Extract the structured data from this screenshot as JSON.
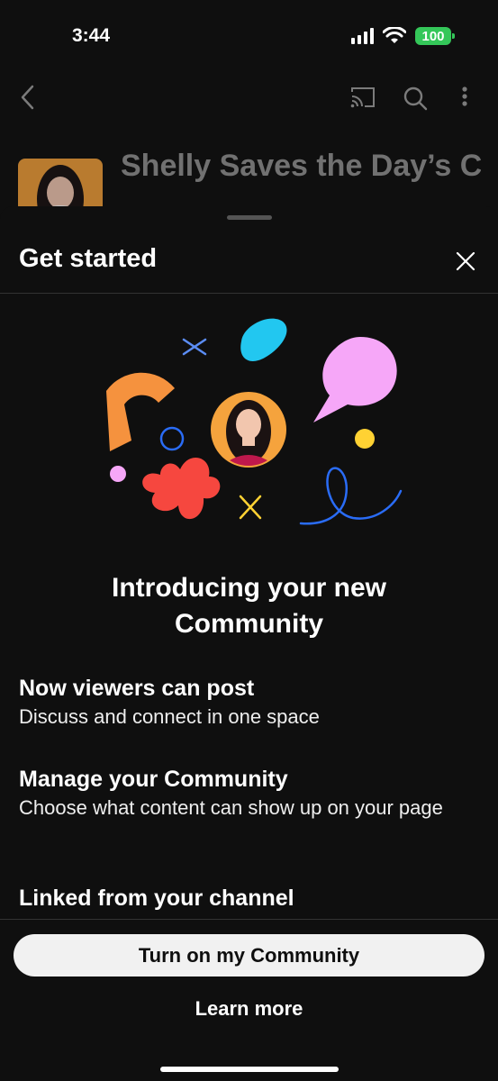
{
  "status_bar": {
    "time": "3:44",
    "battery": "100"
  },
  "background": {
    "channel_title": "Shelly Saves the Day’s Community"
  },
  "sheet": {
    "title": "Get started",
    "headline": "Introducing your new Community",
    "features": [
      {
        "title": "Now viewers can post",
        "description": "Discuss and connect in one space"
      },
      {
        "title": "Manage your Community",
        "description": "Choose what content can show up on your page"
      },
      {
        "title": "Linked from your channel",
        "description": ""
      }
    ],
    "primary_button": "Turn on my Community",
    "secondary_link": "Learn more"
  },
  "colors": {
    "orange": "#f5923e",
    "cyan": "#22c7f0",
    "pink": "#f6a7f8",
    "yellow": "#ffd233",
    "red": "#f6473f",
    "blue": "#2a6cf6",
    "battery_green": "#34c759"
  }
}
